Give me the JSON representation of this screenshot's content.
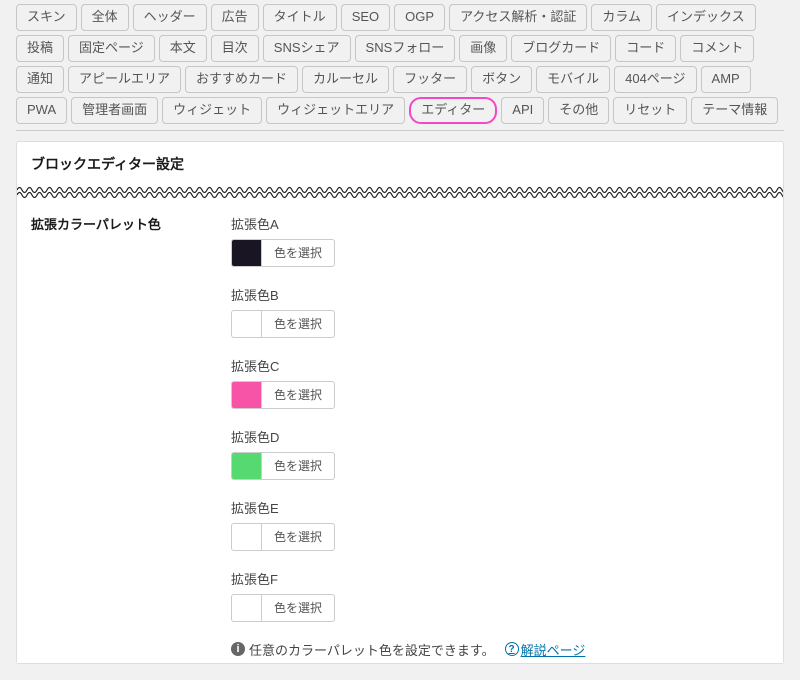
{
  "tabs": {
    "row1": [
      "スキン",
      "全体",
      "ヘッダー",
      "広告",
      "タイトル",
      "SEO",
      "OGP",
      "アクセス解析・認証",
      "カラム",
      "インデックス",
      "投稿"
    ],
    "row2": [
      "固定ページ",
      "本文",
      "目次",
      "SNSシェア",
      "SNSフォロー",
      "画像",
      "ブログカード",
      "コード",
      "コメント",
      "通知",
      "アピールエリア"
    ],
    "row3": [
      "おすすめカード",
      "カルーセル",
      "フッター",
      "ボタン",
      "モバイル",
      "404ページ",
      "AMP",
      "PWA",
      "管理者画面",
      "ウィジェット"
    ],
    "row4": [
      "ウィジェットエリア",
      "エディター",
      "API",
      "その他",
      "リセット",
      "テーマ情報"
    ],
    "highlight": "エディター"
  },
  "panel_title": "ブロックエディター設定",
  "section_label": "拡張カラーパレット色",
  "pick_label": "色を選択",
  "swatches": [
    {
      "key": "a",
      "label": "拡張色A",
      "color": "#1a1522"
    },
    {
      "key": "b",
      "label": "拡張色B",
      "color": ""
    },
    {
      "key": "c",
      "label": "拡張色C",
      "color": "#f754a8"
    },
    {
      "key": "d",
      "label": "拡張色D",
      "color": "#56d970"
    },
    {
      "key": "e",
      "label": "拡張色E",
      "color": ""
    },
    {
      "key": "f",
      "label": "拡張色F",
      "color": ""
    }
  ],
  "hint_text": "任意のカラーパレット色を設定できます。",
  "help_text": "解説ページ"
}
